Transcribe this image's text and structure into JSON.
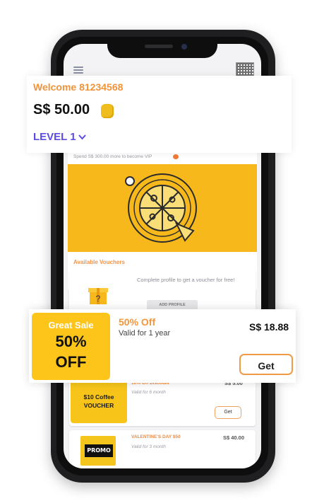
{
  "header": {
    "welcome": "Welcome 81234568",
    "balance": "S$ 50.00",
    "level": "LEVEL 1"
  },
  "screen": {
    "vip_hint": "Spend S$ 300.00 more to become VIP",
    "section_title": "Available Vouchers"
  },
  "vouchers": [
    {
      "text": "Complete profile to get a voucher for free!",
      "button": "ADD PROFILE"
    },
    {
      "badge_line1": "$10 Coffee",
      "badge_line2": "VOUCHER",
      "title": "10% Off Discount",
      "valid": "Valid for 6 month",
      "price": "S$ 5.00",
      "button": "Get"
    },
    {
      "badge_text": "PROMO",
      "title": "VALENTINE'S DAY $50",
      "valid": "Valid for 3 month",
      "price": "S$ 40.00"
    }
  ],
  "featured": {
    "tile_label": "Great Sale",
    "tile_percent": "50%",
    "tile_off": "OFF",
    "title": "50% Off",
    "valid": "Valid for 1 year",
    "price": "S$ 18.88",
    "button": "Get"
  },
  "icons": [
    "menu-icon",
    "qr-code-icon",
    "pizza-icon",
    "gift-icon",
    "coin-icon",
    "chevron-down-icon"
  ],
  "colors": {
    "accent_orange": "#f0933b",
    "level_purple": "#5b4be0",
    "brand_yellow": "#f6b81b"
  }
}
